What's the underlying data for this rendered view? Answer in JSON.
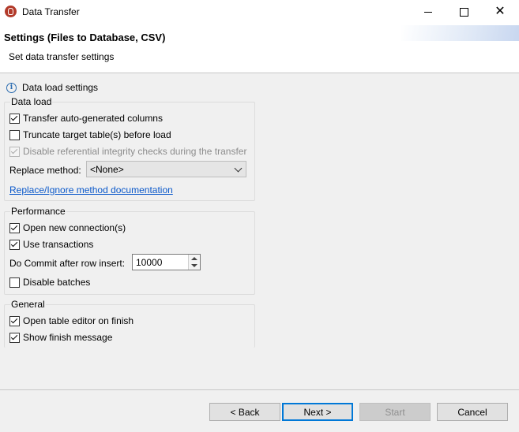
{
  "window": {
    "title": "Data Transfer",
    "minimize_icon": "minimize-icon",
    "maximize_icon": "maximize-icon",
    "close_icon": "close-icon"
  },
  "header": {
    "title": "Settings (Files to Database, CSV)",
    "subtitle": "Set data transfer settings"
  },
  "section": {
    "icon": "info-icon",
    "title": "Data load settings"
  },
  "data_load": {
    "title": "Data load",
    "options": [
      {
        "label": "Transfer auto-generated columns",
        "checked": true,
        "enabled": true
      },
      {
        "label": "Truncate target table(s) before load",
        "checked": false,
        "enabled": true
      },
      {
        "label": "Disable referential integrity checks during the transfer",
        "checked": true,
        "enabled": false
      }
    ],
    "replace_method_label": "Replace method:",
    "replace_method_value": "<None>",
    "doc_link": "Replace/Ignore method documentation"
  },
  "performance": {
    "title": "Performance",
    "open_new_connections": {
      "label": "Open new connection(s)",
      "checked": true
    },
    "use_transactions": {
      "label": "Use transactions",
      "checked": true
    },
    "commit_label": "Do Commit after row insert:",
    "commit_value": "10000",
    "disable_batches": {
      "label": "Disable batches",
      "checked": false
    }
  },
  "general": {
    "title": "General",
    "options": [
      {
        "label": "Open table editor on finish",
        "checked": true
      },
      {
        "label": "Show finish message",
        "checked": true
      }
    ]
  },
  "buttons": {
    "back": "< Back",
    "next": "Next >",
    "start": "Start",
    "cancel": "Cancel"
  },
  "colors": {
    "accent": "#0078d7",
    "link": "#0a58ca",
    "background": "#f0f0f0"
  }
}
